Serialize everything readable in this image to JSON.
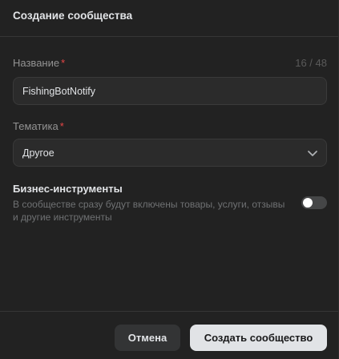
{
  "modal": {
    "title": "Создание сообщества"
  },
  "name_field": {
    "label": "Название",
    "required_mark": "*",
    "counter": "16 / 48",
    "value": "FishingBotNotify"
  },
  "topic_field": {
    "label": "Тематика",
    "required_mark": "*",
    "value": "Другое",
    "icon": "chevron-down-icon"
  },
  "business_tools": {
    "title": "Бизнес-инструменты",
    "description": "В сообществе сразу будут включены товары, услуги, отзывы и другие инструменты",
    "enabled": false
  },
  "footer": {
    "cancel_label": "Отмена",
    "create_label": "Создать сообщество"
  },
  "colors": {
    "background": "#222222",
    "field_bg": "#2b2b2b",
    "required": "#e64646",
    "primary_button": "#e1e3e6",
    "secondary_button": "#333435"
  }
}
